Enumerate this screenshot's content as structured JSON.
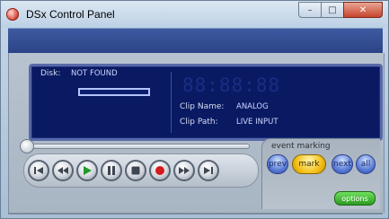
{
  "window": {
    "title": "DSx Control Panel",
    "controls": {
      "minimize": "–",
      "maximize": "□",
      "close": "✕"
    }
  },
  "display": {
    "disk_label": "Disk:",
    "disk_value": "NOT FOUND",
    "timecode": "88:88:88",
    "clip_name_label": "Clip Name:",
    "clip_name_value": "ANALOG",
    "clip_path_label": "Clip Path:",
    "clip_path_value": "LIVE INPUT"
  },
  "transport": {
    "buttons": [
      {
        "name": "skip-to-start",
        "icon": "skip-back-icon"
      },
      {
        "name": "rewind",
        "icon": "rewind-icon"
      },
      {
        "name": "play",
        "icon": "play-icon"
      },
      {
        "name": "pause",
        "icon": "pause-icon"
      },
      {
        "name": "stop",
        "icon": "stop-icon"
      },
      {
        "name": "record",
        "icon": "record-icon"
      },
      {
        "name": "fast-forward",
        "icon": "fast-forward-icon"
      },
      {
        "name": "skip-to-end",
        "icon": "skip-forward-icon"
      }
    ],
    "position": 0
  },
  "event_marking": {
    "label": "event marking",
    "prev": "prev",
    "mark": "mark",
    "next": "next",
    "all": "all",
    "options": "options"
  },
  "colors": {
    "display_bg": "#091a63",
    "play_green": "#1f9a2a",
    "record_red": "#d61a1a",
    "mark_yellow": "#f4c21a",
    "options_green": "#2d9b22"
  }
}
